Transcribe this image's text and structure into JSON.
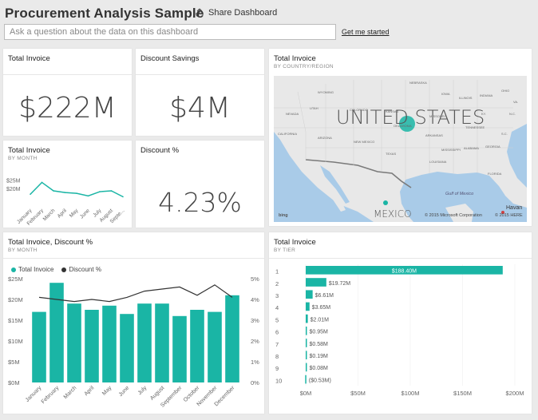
{
  "header": {
    "title": "Procurement Analysis Sample",
    "share_label": "Share Dashboard",
    "qa_placeholder": "Ask a question about the data on this dashboard",
    "get_started": "Get me started"
  },
  "colors": {
    "teal": "#1ab5a5",
    "line": "#333333",
    "water": "#a9cbe8",
    "land": "#e6e6e6"
  },
  "tiles": {
    "total_invoice": {
      "title": "Total Invoice",
      "value": "$222M"
    },
    "discount_savings": {
      "title": "Discount Savings",
      "value": "$4M"
    },
    "invoice_month": {
      "title": "Total Invoice",
      "subtitle": "BY MONTH"
    },
    "discount_pct": {
      "title": "Discount %",
      "value": "4.23%"
    },
    "map": {
      "title": "Total Invoice",
      "subtitle": "BY COUNTRY/REGION",
      "us_label": "UNITED STATES",
      "mexico_label": "MEXICO",
      "ms_credit": "© 2015 Microsoft Corporation",
      "here_credit": "© 2015 HERE",
      "bing": "bing",
      "gulf": "Gulf of Mexico",
      "havana": "Havan",
      "states": [
        "NEBRASKA",
        "WYOMING",
        "IOWA",
        "NEVADA",
        "UTAH",
        "COLORADO",
        "KANSAS",
        "ILLINOIS",
        "MISSOURI",
        "INDIANA",
        "OHIO",
        "CALIFORNIA",
        "OKLAHOMA",
        "ARKANSAS",
        "TENNESSEE",
        "ARIZONA",
        "NEW MEXICO",
        "TEXAS",
        "MISSISSIPPI",
        "ALABAMA",
        "GEORGIA",
        "LOUISIANA",
        "FLORIDA",
        "S.C.",
        "N.C.",
        "VA.",
        "KY."
      ]
    },
    "combo": {
      "title": "Total Invoice, Discount %",
      "subtitle": "BY MONTH",
      "legend_invoice": "Total Invoice",
      "legend_discount": "Discount %"
    },
    "tier": {
      "title": "Total Invoice",
      "subtitle": "BY TIER"
    }
  },
  "chart_data": [
    {
      "type": "line",
      "name": "invoice-by-month-mini",
      "categories": [
        "January",
        "February",
        "March",
        "April",
        "May",
        "June",
        "July",
        "August",
        "September"
      ],
      "values": [
        17,
        24,
        19,
        18,
        17.5,
        16,
        18.5,
        19,
        15.5
      ],
      "ylim": [
        10,
        28
      ],
      "yticks": [
        "$25M",
        "$20M"
      ],
      "xlabels": [
        "January",
        "February",
        "March",
        "April",
        "May",
        "June",
        "July",
        "August",
        "Septe..."
      ]
    },
    {
      "type": "bar",
      "name": "invoice-discount-by-month",
      "categories": [
        "January",
        "February",
        "March",
        "April",
        "May",
        "June",
        "July",
        "August",
        "September",
        "October",
        "November",
        "December"
      ],
      "series": [
        {
          "name": "Total Invoice",
          "type": "bar",
          "values": [
            17,
            24,
            19,
            17.5,
            18.5,
            16.5,
            19,
            19,
            16,
            17.5,
            17,
            21
          ]
        },
        {
          "name": "Discount %",
          "type": "line",
          "values": [
            4.1,
            4.0,
            3.9,
            4.0,
            3.9,
            4.1,
            4.4,
            4.5,
            4.6,
            4.2,
            4.7,
            4.1
          ]
        }
      ],
      "y_left": {
        "min": 0,
        "max": 25,
        "ticks": [
          "$0M",
          "$5M",
          "$10M",
          "$15M",
          "$20M",
          "$25M"
        ]
      },
      "y_right": {
        "min": 0,
        "max": 5,
        "ticks": [
          "0%",
          "1%",
          "2%",
          "3%",
          "4%",
          "5%"
        ]
      }
    },
    {
      "type": "bar",
      "orientation": "horizontal",
      "name": "invoice-by-tier",
      "categories": [
        "1",
        "2",
        "3",
        "4",
        "5",
        "6",
        "7",
        "8",
        "9",
        "10"
      ],
      "values": [
        188.4,
        19.72,
        6.61,
        3.65,
        2.01,
        0.95,
        0.58,
        0.19,
        0.08,
        -0.53
      ],
      "labels": [
        "$188.40M",
        "$19.72M",
        "$6.61M",
        "$3.65M",
        "$2.01M",
        "$0.95M",
        "$0.58M",
        "$0.19M",
        "$0.08M",
        "($0.53M)"
      ],
      "xlim": [
        0,
        200
      ],
      "xticks": [
        "$0M",
        "$50M",
        "$100M",
        "$150M",
        "$200M"
      ]
    }
  ]
}
